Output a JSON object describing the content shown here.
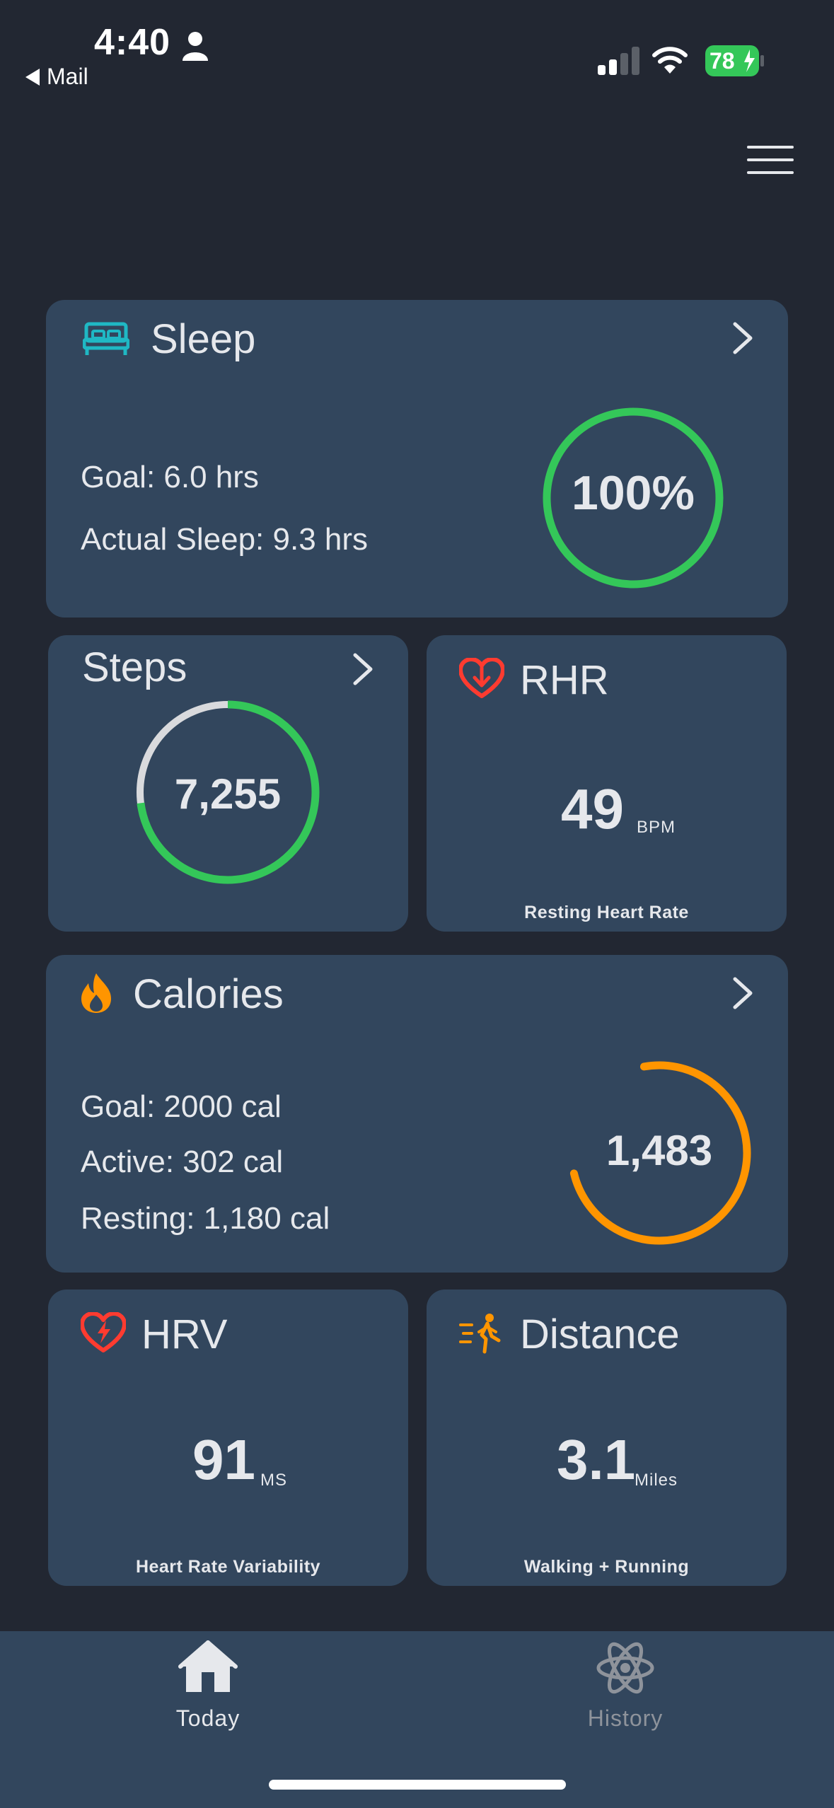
{
  "status_bar": {
    "time": "4:40",
    "back_label": "Mail",
    "battery": "78"
  },
  "colors": {
    "background": "#222732",
    "card": "#32465d",
    "green": "#34c759",
    "orange": "#ff9500",
    "red": "#ff3b30",
    "teal": "#1fb8c4",
    "track": "#d9dadd"
  },
  "sleep": {
    "title": "Sleep",
    "icon": "bed-icon",
    "goal": "Goal: 6.0 hrs",
    "actual": "Actual Sleep: 9.3 hrs",
    "ring_label": "100%",
    "progress": 1.0
  },
  "steps": {
    "title": "Steps",
    "value": "7,255",
    "progress": 0.73
  },
  "rhr": {
    "title": "RHR",
    "icon": "heart-down-arrow-icon",
    "value": "49",
    "unit": "BPM",
    "caption": "Resting Heart Rate"
  },
  "calories": {
    "title": "Calories",
    "icon": "flame-icon",
    "goal": "Goal: 2000 cal",
    "active": "Active: 302 cal",
    "resting": "Resting: 1,180 cal",
    "ring_label": "1,483",
    "progress": 0.74
  },
  "hrv": {
    "title": "HRV",
    "icon": "heart-bolt-icon",
    "value": "91",
    "unit": "MS",
    "caption": "Heart Rate Variability"
  },
  "distance": {
    "title": "Distance",
    "icon": "walking-person-icon",
    "value": "3.1",
    "unit": "Miles",
    "caption": "Walking + Running"
  },
  "tabs": [
    {
      "label": "Today",
      "icon": "home-icon",
      "active": true
    },
    {
      "label": "History",
      "icon": "atom-icon",
      "active": false
    }
  ]
}
